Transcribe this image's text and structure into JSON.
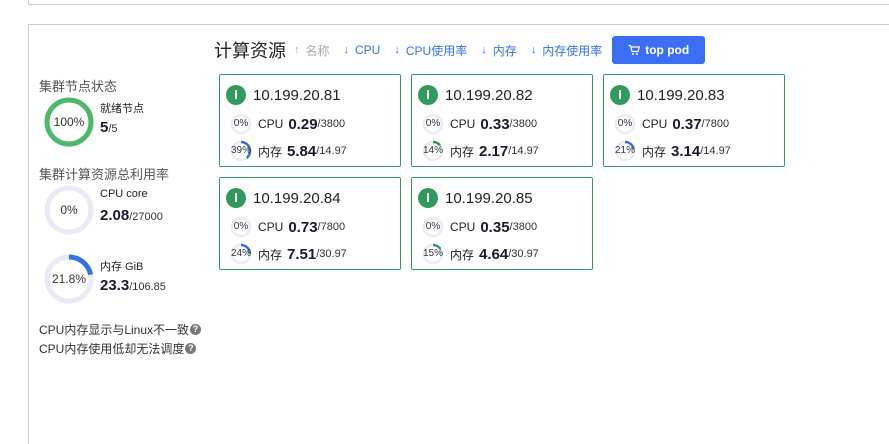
{
  "toolbar": {
    "title": "计算资源",
    "sort_name": "名称",
    "sort_cpu": "CPU",
    "sort_cpu_usage": "CPU使用率",
    "sort_mem": "内存",
    "sort_mem_usage": "内存使用率",
    "top_pod": "top pod",
    "accent": "#3b6ef5"
  },
  "sidebar": {
    "node_status_title": "集群节点状态",
    "ready_pct": "100%",
    "ready_fraction": 1.0,
    "ready_label": "就绪节点",
    "ready_count": "5",
    "ready_total": "/5",
    "util_title": "集群计算资源总利用率",
    "cpu_pct": "0%",
    "cpu_fraction": 0.0,
    "cpu_label": "CPU core",
    "cpu_value": "2.08",
    "cpu_total": "/27000",
    "mem_pct": "21.8%",
    "mem_fraction": 0.218,
    "mem_label": "内存 GiB",
    "mem_value": "23.3",
    "mem_total": "/106.85",
    "note1": "CPU内存显示与Linux不一致",
    "note2": "CPU内存使用低却无法调度",
    "help_glyph": "?"
  },
  "nodes": [
    {
      "badge": "I",
      "ip": "10.199.20.81",
      "cpu_pct": "0%",
      "cpu_frac": 0.0,
      "cpu_label": "CPU",
      "cpu_value": "0.29",
      "cpu_total": "/3800",
      "mem_pct": "39%",
      "mem_frac": 0.39,
      "mem_label": "内存",
      "mem_value": "5.84",
      "mem_total": "/14.97"
    },
    {
      "badge": "I",
      "ip": "10.199.20.82",
      "cpu_pct": "0%",
      "cpu_frac": 0.0,
      "cpu_label": "CPU",
      "cpu_value": "0.33",
      "cpu_total": "/3800",
      "mem_pct": "14%",
      "mem_frac": 0.14,
      "mem_label": "内存",
      "mem_value": "2.17",
      "mem_total": "/14.97"
    },
    {
      "badge": "I",
      "ip": "10.199.20.83",
      "cpu_pct": "0%",
      "cpu_frac": 0.0,
      "cpu_label": "CPU",
      "cpu_value": "0.37",
      "cpu_total": "/7800",
      "mem_pct": "21%",
      "mem_frac": 0.21,
      "mem_label": "内存",
      "mem_value": "3.14",
      "mem_total": "/14.97"
    },
    {
      "badge": "I",
      "ip": "10.199.20.84",
      "cpu_pct": "0%",
      "cpu_frac": 0.0,
      "cpu_label": "CPU",
      "cpu_value": "0.73",
      "cpu_total": "/7800",
      "mem_pct": "24%",
      "mem_frac": 0.24,
      "mem_label": "内存",
      "mem_value": "7.51",
      "mem_total": "/30.97"
    },
    {
      "badge": "I",
      "ip": "10.199.20.85",
      "cpu_pct": "0%",
      "cpu_frac": 0.0,
      "cpu_label": "CPU",
      "cpu_value": "0.35",
      "cpu_total": "/3800",
      "mem_pct": "15%",
      "mem_frac": 0.15,
      "mem_label": "内存",
      "mem_value": "4.64",
      "mem_total": "/30.97"
    }
  ],
  "colors": {
    "ready_ring": "#4cb86a",
    "usage_ring": "#3572e6",
    "mem_ring_low": "#2e9a5c",
    "track": "#e8ebf5",
    "card_border": "#2e9a5c"
  }
}
